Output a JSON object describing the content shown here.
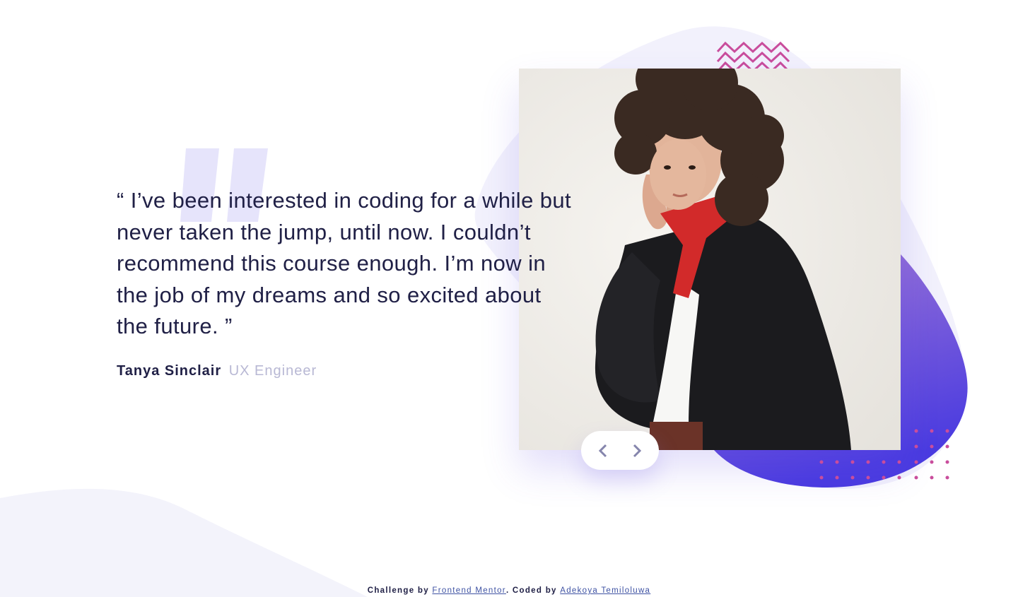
{
  "testimonial": {
    "quote": "“ I’ve been interested in coding for a while but never taken the jump, until now. I couldn’t recommend this course enough. I’m now in the job of my dreams and so excited about the future. ”",
    "author_name": "Tanya Sinclair",
    "author_role": "UX Engineer"
  },
  "navigation": {
    "prev_icon": "chevron-left-icon",
    "next_icon": "chevron-right-icon"
  },
  "attribution": {
    "prefix": "Challenge by",
    "link1": "Frontend Mentor",
    "middle": ". Coded by",
    "link2": "Adekoya Temiloluwa"
  },
  "colors": {
    "text_dark": "#202046",
    "text_muted": "#b8b8d4",
    "blob_gradient_start": "#8c6ad8",
    "blob_gradient_end": "#4a3be0",
    "accent_pink": "#c24d9a",
    "background_wave": "#f3f3fb"
  }
}
